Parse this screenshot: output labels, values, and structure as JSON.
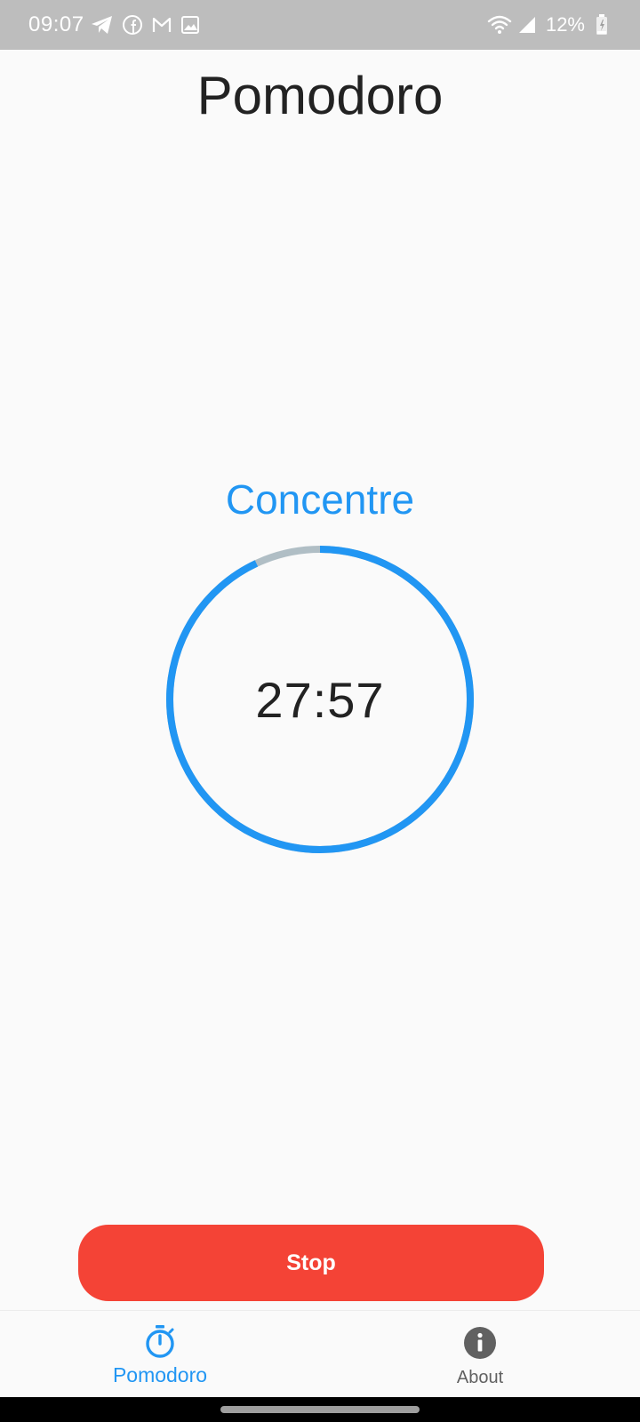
{
  "status_bar": {
    "time": "09:07",
    "battery_percent": "12%",
    "left_icons": [
      "telegram-icon",
      "facebook-icon",
      "gmail-icon",
      "gallery-icon"
    ],
    "right_icons": [
      "wifi-icon",
      "cell-signal-icon",
      "battery-icon"
    ]
  },
  "app": {
    "title": "Pomodoro"
  },
  "timer": {
    "phase": "Concentre",
    "time_remaining": "27:57",
    "progress_elapsed_fraction": 0.07
  },
  "actions": {
    "stop_label": "Stop"
  },
  "bottom_nav": {
    "items": [
      {
        "label": "Pomodoro",
        "icon": "timer-icon",
        "active": true
      },
      {
        "label": "About",
        "icon": "info-icon",
        "active": false
      }
    ]
  },
  "colors": {
    "accent": "#2196f3",
    "stop": "#f44336",
    "track": "#b0bec5",
    "status_bar": "#bdbdbd"
  }
}
